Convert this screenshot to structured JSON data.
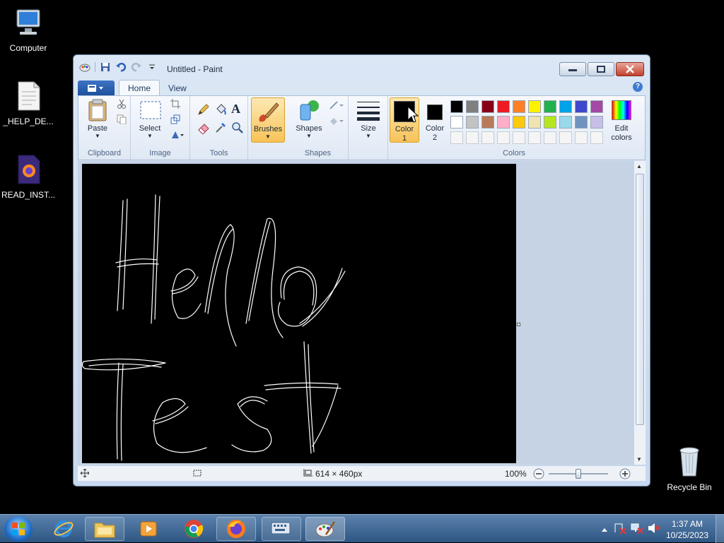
{
  "desktop": {
    "icons": [
      {
        "label": "Computer"
      },
      {
        "label": "_HELP_DE..."
      },
      {
        "label": "READ_INST..."
      },
      {
        "label": "Recycle Bin"
      }
    ]
  },
  "window": {
    "title": "Untitled - Paint",
    "tabs": [
      "Home",
      "View"
    ],
    "help_icon": "?"
  },
  "ribbon": {
    "clipboard": {
      "paste_label": "Paste",
      "group_label": "Clipboard"
    },
    "image": {
      "select_label": "Select",
      "group_label": "Image"
    },
    "tools": {
      "group_label": "Tools",
      "text_icon": "A"
    },
    "brushes": {
      "label": "Brushes"
    },
    "shapes": {
      "label": "Shapes",
      "group_label": "Shapes"
    },
    "size": {
      "label": "Size"
    },
    "colors": {
      "color1_label": "Color",
      "color1_num": "1",
      "color2_label": "Color",
      "color2_num": "2",
      "color1": "#000000",
      "color2": "#000000",
      "edit_label": "Edit",
      "edit_label2": "colors",
      "group_label": "Colors",
      "palette_row1": [
        "#000000",
        "#7f7f7f",
        "#880015",
        "#ed1c24",
        "#ff7f27",
        "#fff200",
        "#22b14c",
        "#00a2e8",
        "#3f48cc",
        "#a349a4"
      ],
      "palette_row2": [
        "#ffffff",
        "#c3c3c3",
        "#b97a57",
        "#ffaec9",
        "#ffc90e",
        "#efe4b0",
        "#b5e61d",
        "#99d9ea",
        "#7092be",
        "#c8bfe7"
      ]
    }
  },
  "status": {
    "canvas_size": "614 × 460px",
    "zoom": "100%"
  },
  "taskbar": {
    "time": "1:37 AM",
    "date": "10/25/2023"
  }
}
